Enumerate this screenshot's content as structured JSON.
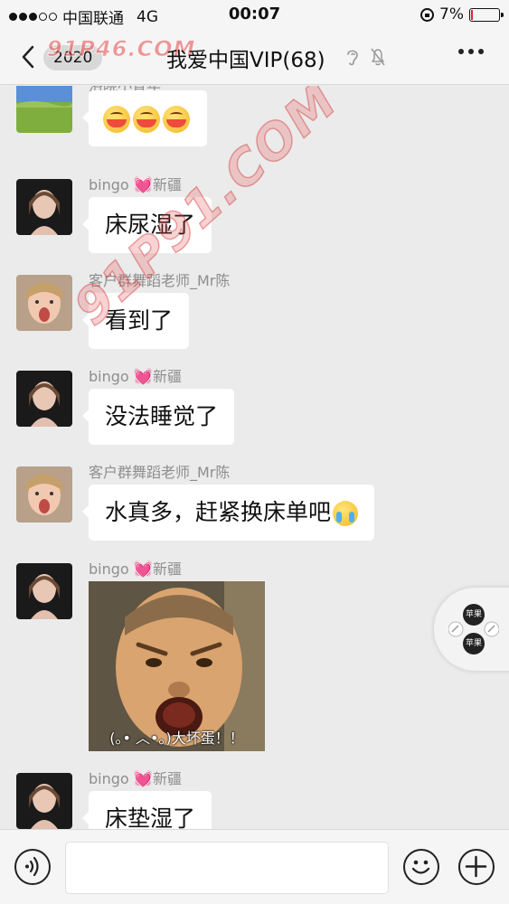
{
  "status_bar": {
    "carrier": "中国联通",
    "network": "4G",
    "time": "00:07",
    "battery_percent": "7%",
    "battery_level": 0.07
  },
  "nav": {
    "back_badge": "2020",
    "title": "我爱中国VIP(68)",
    "watermark_top": "91P46.COM"
  },
  "watermark_diag": "91P91.COM",
  "messages": [
    {
      "sender": "洛晓小青年",
      "sender_heart": "",
      "sender_suffix": "",
      "text": "",
      "kind": "emoji",
      "emoji_count": 3
    },
    {
      "sender": "bingo",
      "sender_heart": "💓",
      "sender_suffix": "新疆",
      "text": "床尿湿了",
      "kind": "text"
    },
    {
      "sender": "客户群舞蹈老师_Mr陈",
      "sender_heart": "",
      "sender_suffix": "",
      "text": "看到了",
      "kind": "text"
    },
    {
      "sender": "bingo",
      "sender_heart": "💓",
      "sender_suffix": "新疆",
      "text": "没法睡觉了",
      "kind": "text"
    },
    {
      "sender": "客户群舞蹈老师_Mr陈",
      "sender_heart": "",
      "sender_suffix": "",
      "text": "水真多，赶紧换床单吧",
      "kind": "text_cry"
    },
    {
      "sender": "bingo",
      "sender_heart": "💓",
      "sender_suffix": "新疆",
      "text": "",
      "kind": "sticker",
      "sticker_caption": "(｡• ︿•｡)大坏蛋！！"
    },
    {
      "sender": "bingo",
      "sender_heart": "💓",
      "sender_suffix": "新疆",
      "text": "床垫湿了",
      "kind": "text"
    }
  ],
  "float_button": {
    "top_label": "苹果",
    "bottom_label": "苹果"
  },
  "input_bar": {
    "placeholder": ""
  },
  "icons": {
    "back": "chevron-left-icon",
    "ear": "ear-icon",
    "mute": "bell-slash-icon",
    "more": "more-dots-icon",
    "voice": "voice-icon",
    "emoji": "smiley-icon",
    "plus": "plus-icon"
  },
  "colors": {
    "background": "#ebebeb",
    "bubble": "#ffffff",
    "sender_text": "#8e8e8e",
    "battery_low": "#e4232f"
  }
}
